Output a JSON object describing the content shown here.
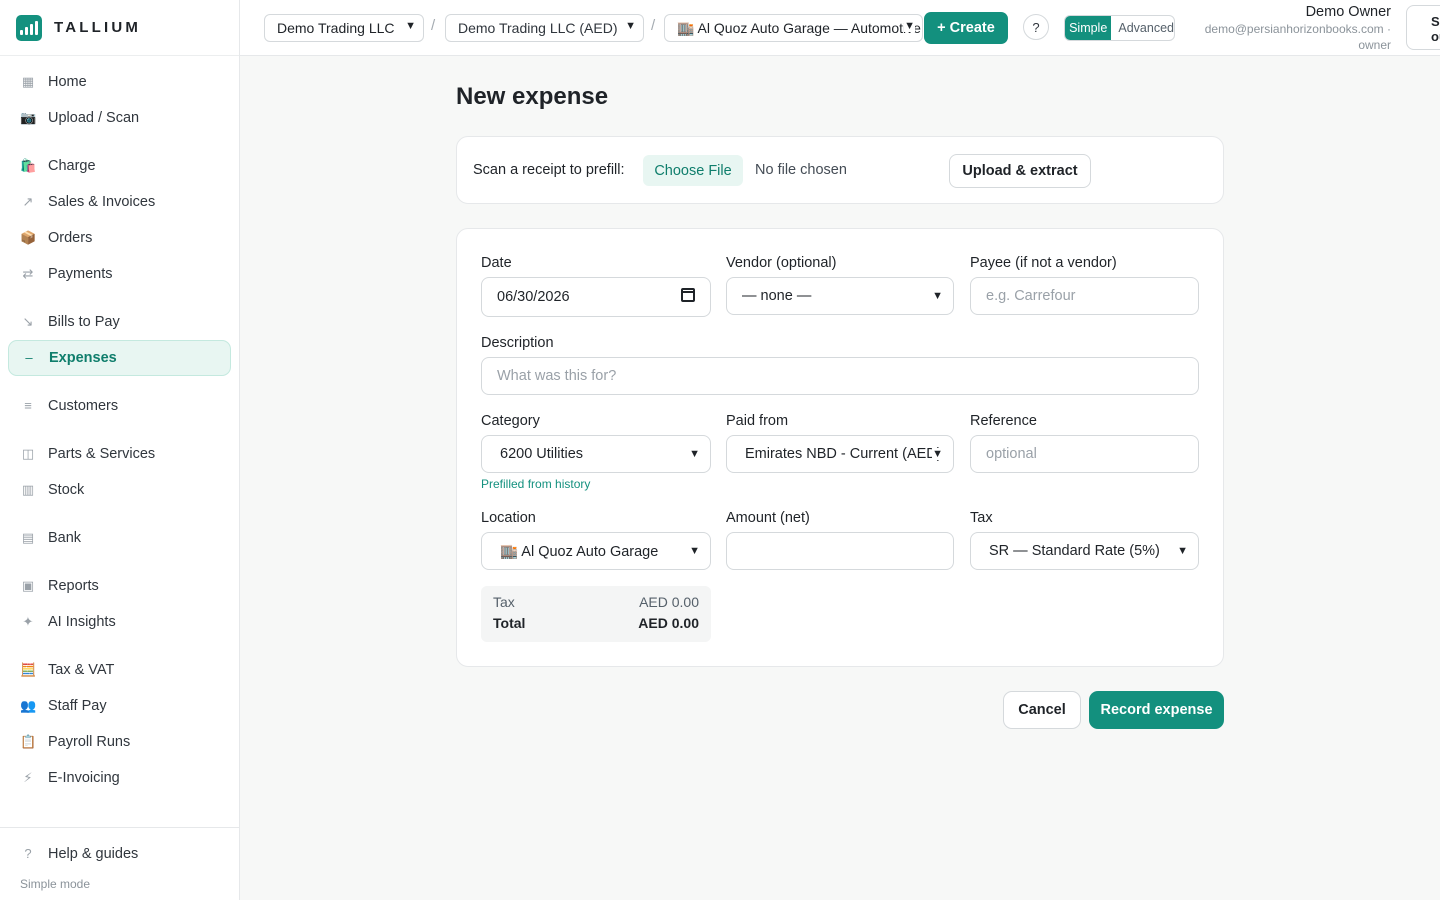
{
  "brand": {
    "name": "TALLIUM"
  },
  "sidebar": {
    "items": [
      {
        "label": "Home",
        "icon": "grid-icon",
        "glyph": "▦"
      },
      {
        "label": "Upload / Scan",
        "icon": "camera-icon",
        "glyph": "📷"
      },
      {
        "label": "Charge",
        "icon": "shopping-bag-icon",
        "glyph": "🛍️"
      },
      {
        "label": "Sales & Invoices",
        "icon": "arrow-up-right-icon",
        "glyph": "↗"
      },
      {
        "label": "Orders",
        "icon": "package-icon",
        "glyph": "📦"
      },
      {
        "label": "Payments",
        "icon": "swap-arrows-icon",
        "glyph": "⇄"
      },
      {
        "label": "Bills to Pay",
        "icon": "arrow-down-right-icon",
        "glyph": "↘"
      },
      {
        "label": "Expenses",
        "icon": "minus-icon",
        "glyph": "–"
      },
      {
        "label": "Customers",
        "icon": "list-icon",
        "glyph": "≡"
      },
      {
        "label": "Parts & Services",
        "icon": "box-icon",
        "glyph": "◫"
      },
      {
        "label": "Stock",
        "icon": "columns-icon",
        "glyph": "▥"
      },
      {
        "label": "Bank",
        "icon": "bank-icon",
        "glyph": "▤"
      },
      {
        "label": "Reports",
        "icon": "report-icon",
        "glyph": "▣"
      },
      {
        "label": "AI Insights",
        "icon": "sparkle-icon",
        "glyph": "✦"
      },
      {
        "label": "Tax & VAT",
        "icon": "abacus-icon",
        "glyph": "🧮"
      },
      {
        "label": "Staff Pay",
        "icon": "people-icon",
        "glyph": "👥"
      },
      {
        "label": "Payroll Runs",
        "icon": "clipboard-icon",
        "glyph": "📋"
      },
      {
        "label": "E-Invoicing",
        "icon": "lightning-icon",
        "glyph": "⚡"
      }
    ],
    "active": "Expenses",
    "help": {
      "label": "Help & guides",
      "glyph": "?"
    },
    "mode_text": "Simple mode"
  },
  "topbar": {
    "company": "Demo Trading LLC",
    "ledger": "Demo Trading LLC (AED)",
    "location": "🏬 Al Quoz Auto Garage — Automotive",
    "separator": "/",
    "create_label": "+ Create",
    "help_label": "?",
    "mode_simple": "Simple",
    "mode_advanced": "Advanced",
    "user_name": "Demo Owner",
    "user_email": "demo@persianhorizonbooks.com · owner",
    "signout_label": "Sign out"
  },
  "page": {
    "title": "New expense"
  },
  "scan": {
    "label": "Scan a receipt to prefill:",
    "choose_file": "Choose File",
    "no_file": "No file chosen",
    "upload_label": "Upload & extract"
  },
  "form": {
    "date_label": "Date",
    "date_value": "06/30/2026",
    "vendor_label": "Vendor (optional)",
    "vendor_value": "— none —",
    "payee_label": "Payee (if not a vendor)",
    "payee_placeholder": "e.g. Carrefour",
    "description_label": "Description",
    "description_placeholder": "What was this for?",
    "category_label": "Category",
    "category_value": "6200 Utilities",
    "category_hint": "Prefilled from history",
    "paid_from_label": "Paid from",
    "paid_from_value": "Emirates NBD - Current (AED)",
    "reference_label": "Reference",
    "reference_placeholder": "optional",
    "location_label": "Location",
    "location_value": "🏬 Al Quoz Auto Garage",
    "amount_label": "Amount (net)",
    "amount_value": "",
    "tax_label": "Tax",
    "tax_value": "SR — Standard Rate (5%)",
    "summary_tax_label": "Tax",
    "summary_tax_value": "AED 0.00",
    "summary_total_label": "Total",
    "summary_total_value": "AED 0.00"
  },
  "actions": {
    "cancel": "Cancel",
    "record": "Record expense"
  },
  "colors": {
    "accent": "#13907e",
    "active_bg": "#e8f6f2",
    "page_bg": "#f7f8f7"
  }
}
